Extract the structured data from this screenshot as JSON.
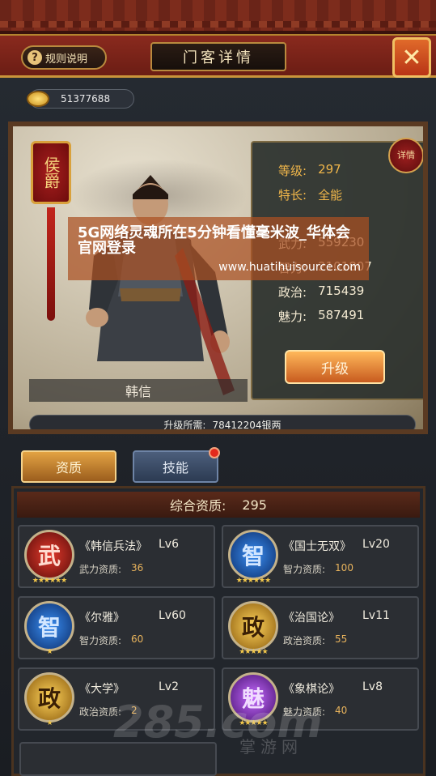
{
  "header": {
    "rules_label": "规则说明",
    "title": "门客详情",
    "close_icon": "close-icon"
  },
  "currency": {
    "icon": "silver-coin-icon",
    "amount": "51377688"
  },
  "hero": {
    "rank": "侯爵",
    "name": "韩信",
    "detail_label": "详情",
    "stats": [
      {
        "key": "等级:",
        "value": "297"
      },
      {
        "key": "特长:",
        "value": "全能"
      },
      {
        "key": "武力:",
        "value": "559230"
      },
      {
        "key": "智力:",
        "value": "2101807"
      },
      {
        "key": "政治:",
        "value": "715439"
      },
      {
        "key": "魅力:",
        "value": "587491"
      }
    ],
    "upgrade_label": "升级",
    "cost_label": "升级所需:",
    "cost_value": "78412204银两"
  },
  "tabs": [
    {
      "label": "资质"
    },
    {
      "label": "技能"
    }
  ],
  "aptitude": {
    "total_label": "综合资质:",
    "total_value": "295",
    "skills": [
      {
        "char": "武",
        "name": "《韩信兵法》",
        "level": "Lv6",
        "attr": "武力资质:",
        "value": "36",
        "stars": "★★★★★★"
      },
      {
        "char": "智",
        "name": "《国士无双》",
        "level": "Lv20",
        "attr": "智力资质:",
        "value": "100",
        "stars": "★★★★★★"
      },
      {
        "char": "智",
        "name": "《尔雅》",
        "level": "Lv60",
        "attr": "智力资质:",
        "value": "60",
        "stars": "★"
      },
      {
        "char": "政",
        "name": "《治国论》",
        "level": "Lv11",
        "attr": "政治资质:",
        "value": "55",
        "stars": "★★★★★"
      },
      {
        "char": "政",
        "name": "《大学》",
        "level": "Lv2",
        "attr": "政治资质:",
        "value": "2",
        "stars": "★"
      },
      {
        "char": "魅",
        "name": "《象棋论》",
        "level": "Lv8",
        "attr": "魅力资质:",
        "value": "40",
        "stars": "★★★★★"
      }
    ]
  },
  "overlay": {
    "title": "5G网络灵魂所在5分钟看懂毫米波_华体会官网登录",
    "url": "www.huatihuisource.com"
  },
  "watermark": {
    "main": "285.com",
    "sub": "掌游网"
  }
}
